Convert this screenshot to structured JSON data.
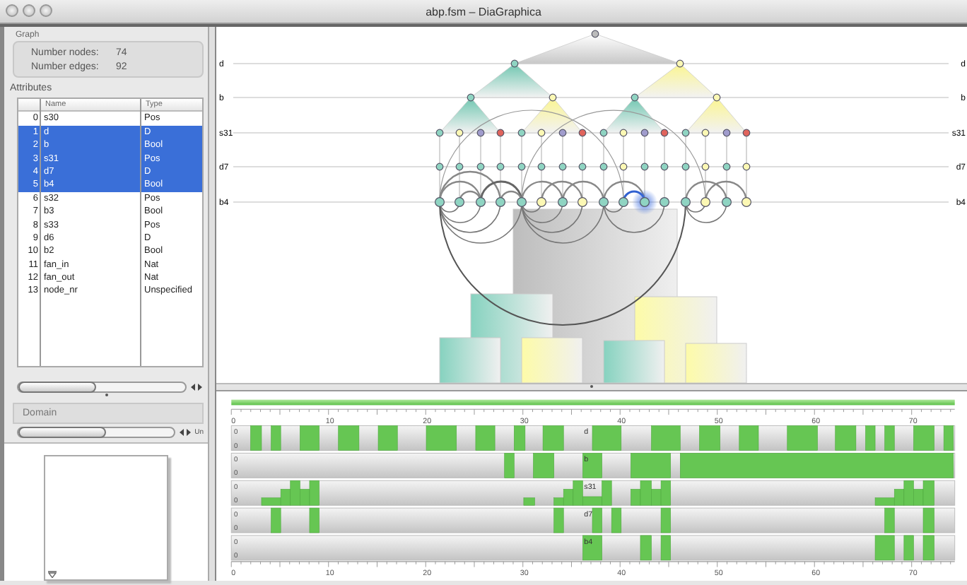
{
  "window": {
    "title": "abp.fsm – DiaGraphica"
  },
  "graph_panel": {
    "title": "Graph",
    "stats": [
      {
        "label": "Number nodes:",
        "value": "74"
      },
      {
        "label": "Number edges:",
        "value": "92"
      }
    ]
  },
  "attributes": {
    "title": "Attributes",
    "columns": [
      "Name",
      "Type"
    ],
    "rows": [
      {
        "index": "0",
        "name": "s30",
        "type": "Pos",
        "selected": false
      },
      {
        "index": "1",
        "name": "d",
        "type": "D",
        "selected": true
      },
      {
        "index": "2",
        "name": "b",
        "type": "Bool",
        "selected": true
      },
      {
        "index": "3",
        "name": "s31",
        "type": "Pos",
        "selected": true
      },
      {
        "index": "4",
        "name": "d7",
        "type": "D",
        "selected": true
      },
      {
        "index": "5",
        "name": "b4",
        "type": "Bool",
        "selected": true
      },
      {
        "index": "6",
        "name": "s32",
        "type": "Pos",
        "selected": false
      },
      {
        "index": "7",
        "name": "b3",
        "type": "Bool",
        "selected": false
      },
      {
        "index": "8",
        "name": "s33",
        "type": "Pos",
        "selected": false
      },
      {
        "index": "9",
        "name": "d6",
        "type": "D",
        "selected": false
      },
      {
        "index": "10",
        "name": "b2",
        "type": "Bool",
        "selected": false
      },
      {
        "index": "11",
        "name": "fan_in",
        "type": "Nat",
        "selected": false
      },
      {
        "index": "12",
        "name": "fan_out",
        "type": "Nat",
        "selected": false
      },
      {
        "index": "13",
        "name": "node_nr",
        "type": "Unspecified",
        "selected": false
      }
    ]
  },
  "domain": {
    "title": "Domain",
    "scroll_text": "Un"
  },
  "diagram": {
    "left_labels": [
      "d",
      "b",
      "s31",
      "d7",
      "b4"
    ],
    "right_labels": [
      "d",
      "b",
      "s31",
      "d7",
      "b4"
    ]
  },
  "timeline": {
    "top_ticks": [
      "0",
      "10",
      "20",
      "30",
      "40",
      "50",
      "60",
      "70"
    ],
    "bottom_ticks": [
      "0",
      "10",
      "20",
      "30",
      "40",
      "50",
      "60",
      "70"
    ],
    "lanes": [
      {
        "label": "d",
        "axis_labels": [
          "0",
          "0"
        ]
      },
      {
        "label": "b",
        "axis_labels": [
          "0",
          "0"
        ]
      },
      {
        "label": "s31",
        "axis_labels": [
          "0",
          "0"
        ]
      },
      {
        "label": "d7",
        "axis_labels": [
          "0",
          "0"
        ]
      },
      {
        "label": "b4",
        "axis_labels": [
          "0",
          "0"
        ]
      }
    ]
  }
}
